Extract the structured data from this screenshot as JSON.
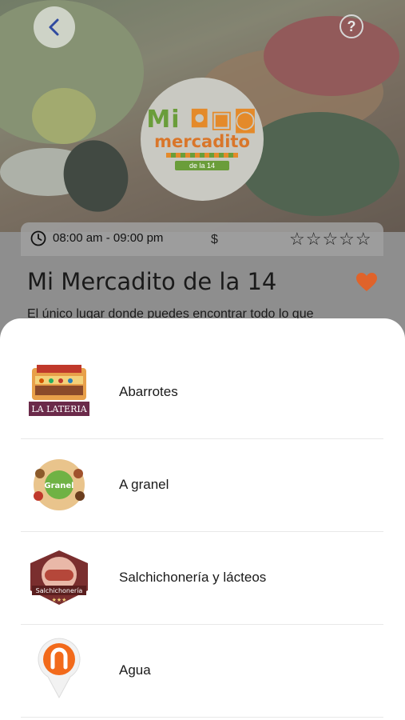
{
  "header": {
    "back_icon": "chevron-left-icon",
    "help_icon": "question-circle-icon",
    "logo_text_top": "Mi",
    "logo_text_mid": "mercadito",
    "logo_text_small": "de la 14"
  },
  "store": {
    "hours": "08:00 am - 09:00 pm",
    "price_level": "$",
    "rating_stars": "☆☆☆☆☆",
    "rating_value": 0,
    "name": "Mi Mercadito de la 14",
    "description": "El único lugar donde puedes encontrar todo lo que",
    "favorite": true
  },
  "categories": [
    {
      "label": "Abarrotes",
      "icon": "abarrotes-la-lateria-logo"
    },
    {
      "label": "A granel",
      "icon": "granel-logo"
    },
    {
      "label": "Salchichonería y lácteos",
      "icon": "salchichoneria-logo"
    },
    {
      "label": "Agua",
      "icon": "agua-location-pin-logo"
    }
  ],
  "colors": {
    "accent": "#e0632a",
    "green": "#6a9d3a",
    "orange": "#e48a2a",
    "back_arrow": "#2f4aa0"
  }
}
